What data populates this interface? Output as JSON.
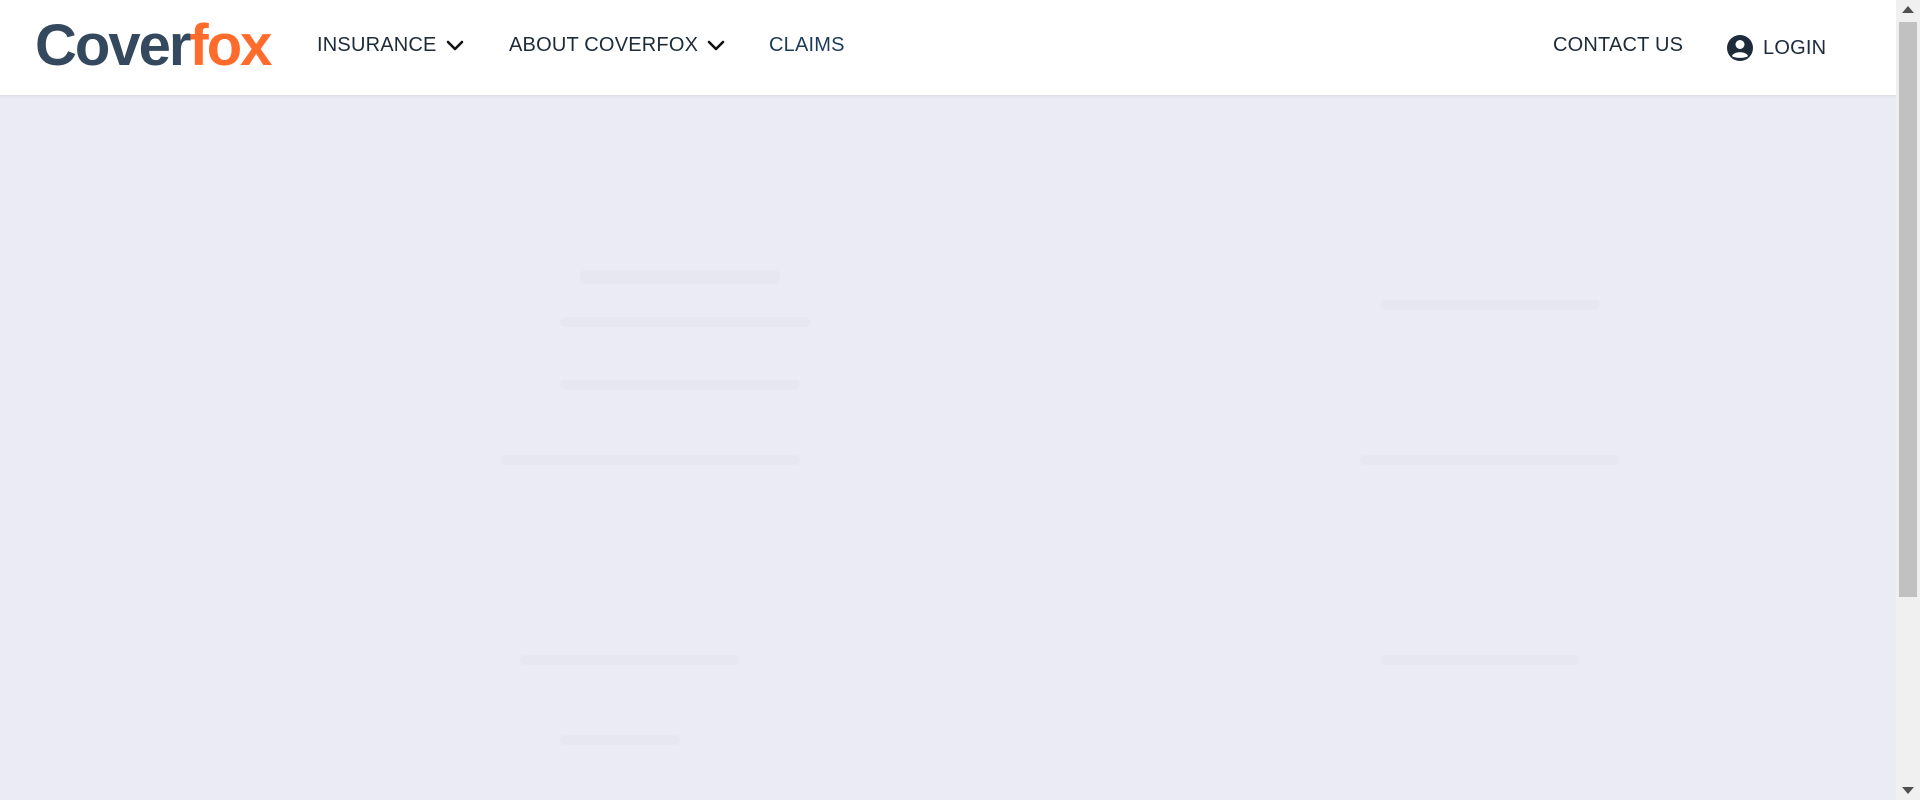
{
  "brand": {
    "logo_part1": "Cover",
    "logo_part2": "fox",
    "colors": {
      "primary_dark": "#34495e",
      "accent_orange": "#ff6b2b",
      "page_background": "#eaebf4"
    }
  },
  "nav": {
    "insurance": "INSURANCE",
    "about": "ABOUT COVERFOX",
    "claims": "CLAIMS",
    "contact": "CONTACT US",
    "login": "LOGIN"
  },
  "icons": {
    "insurance_dropdown": "chevron-down-icon",
    "about_dropdown": "chevron-down-icon",
    "login_user": "user-circle-icon"
  }
}
